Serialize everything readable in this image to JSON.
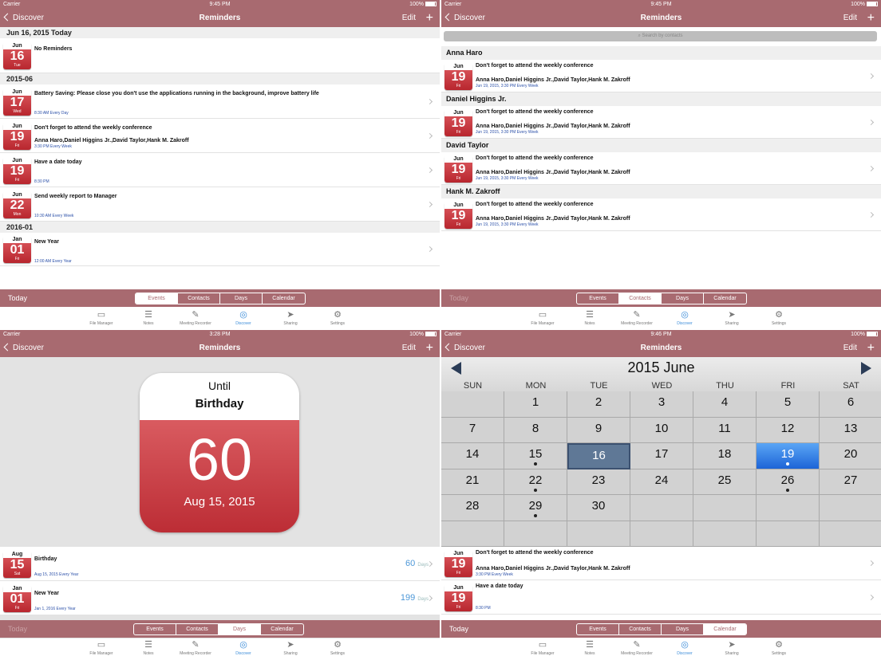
{
  "status": {
    "carrier": "Carrier",
    "battery": "100%",
    "times": [
      "9:45 PM",
      "9:45 PM",
      "3:28 PM",
      "9:46 PM"
    ]
  },
  "nav": {
    "back": "Discover",
    "title": "Reminders",
    "edit": "Edit",
    "plus": "+"
  },
  "segments": [
    "Events",
    "Contacts",
    "Days",
    "Calendar"
  ],
  "toolbar_today": "Today",
  "tabs": [
    "File Manager",
    "Notes",
    "Meeting Recorder",
    "Discover",
    "Sharing",
    "Settings"
  ],
  "events": {
    "sections": [
      {
        "header": "Jun 16, 2015 Today",
        "rows": [
          {
            "mon": "Jun",
            "day": "16",
            "wd": "Tue",
            "title": "No Reminders",
            "sub1": "",
            "sub2": ""
          }
        ]
      },
      {
        "header": "2015-06",
        "rows": [
          {
            "mon": "Jun",
            "day": "17",
            "wd": "Wed",
            "title": "Battery Saving: Please close you don't use the applications running in the background, improve battery life",
            "sub1": "",
            "sub2": "8:30 AM Every Day"
          },
          {
            "mon": "Jun",
            "day": "19",
            "wd": "Fri",
            "title": "Don't forget to attend the weekly conference",
            "sub1": "Anna Haro,Daniel Higgins Jr.,David Taylor,Hank M. Zakroff",
            "sub2": "3:30 PM Every Week"
          },
          {
            "mon": "Jun",
            "day": "19",
            "wd": "Fri",
            "title": "Have a date today",
            "sub1": "",
            "sub2": "8:30 PM"
          },
          {
            "mon": "Jun",
            "day": "22",
            "wd": "Mon",
            "title": "Send weekly report to Manager",
            "sub1": "",
            "sub2": "10:30 AM Every Week"
          }
        ]
      },
      {
        "header": "2016-01",
        "rows": [
          {
            "mon": "Jan",
            "day": "01",
            "wd": "Fri",
            "title": "New Year",
            "sub1": "",
            "sub2": "12:00 AM Every Year"
          }
        ]
      }
    ]
  },
  "contacts": {
    "search_placeholder": "Search by contacts",
    "people": [
      {
        "name": "Anna Haro",
        "mon": "Jun",
        "day": "19",
        "wd": "Fri",
        "title": "Don't forget to attend the weekly conference",
        "sub1": "Anna Haro,Daniel Higgins Jr.,David Taylor,Hank M. Zakroff",
        "sub2": "Jun 19, 2015, 3:30 PM Every Week"
      },
      {
        "name": "Daniel Higgins Jr.",
        "mon": "Jun",
        "day": "19",
        "wd": "Fri",
        "title": "Don't forget to attend the weekly conference",
        "sub1": "Anna Haro,Daniel Higgins Jr.,David Taylor,Hank M. Zakroff",
        "sub2": "Jun 19, 2015, 3:30 PM Every Week"
      },
      {
        "name": "David Taylor",
        "mon": "Jun",
        "day": "19",
        "wd": "Fri",
        "title": "Don't forget to attend the weekly conference",
        "sub1": "Anna Haro,Daniel Higgins Jr.,David Taylor,Hank M. Zakroff",
        "sub2": "Jun 19, 2015, 3:30 PM Every Week"
      },
      {
        "name": "Hank M. Zakroff",
        "mon": "Jun",
        "day": "19",
        "wd": "Fri",
        "title": "Don't forget to attend the weekly conference",
        "sub1": "Anna Haro,Daniel Higgins Jr.,David Taylor,Hank M. Zakroff",
        "sub2": "Jun 19, 2015, 3:30 PM Every Week"
      }
    ]
  },
  "days": {
    "card": {
      "until": "Until",
      "name": "Birthday",
      "count": "60",
      "date": "Aug 15, 2015"
    },
    "rows": [
      {
        "mon": "Aug",
        "day": "15",
        "wd": "Sat",
        "title": "Birthday",
        "sub2": "Aug 15, 2015 Every Year",
        "count": "60",
        "unit": "Days"
      },
      {
        "mon": "Jan",
        "day": "01",
        "wd": "Fri",
        "title": "New Year",
        "sub2": "Jan 1, 2016 Every Year",
        "count": "199",
        "unit": "Days"
      }
    ]
  },
  "calendar": {
    "month": "2015 June",
    "weekdays": [
      "SUN",
      "MON",
      "TUE",
      "WED",
      "THU",
      "FRI",
      "SAT"
    ],
    "days": [
      "",
      "1",
      "2",
      "3",
      "4",
      "5",
      "6",
      "7",
      "8",
      "9",
      "10",
      "11",
      "12",
      "13",
      "14",
      "15",
      "16",
      "17",
      "18",
      "19",
      "20",
      "21",
      "22",
      "23",
      "24",
      "25",
      "26",
      "27",
      "28",
      "29",
      "30",
      "",
      "",
      "",
      "",
      "",
      "",
      "",
      "",
      "",
      "",
      "",
      ""
    ],
    "dots": [
      "15",
      "19",
      "22",
      "26",
      "29"
    ],
    "selected": "16",
    "today": "19",
    "rows": [
      {
        "mon": "Jun",
        "day": "19",
        "wd": "Fri",
        "title": "Don't forget to attend the weekly conference",
        "sub1": "Anna Haro,Daniel Higgins Jr.,David Taylor,Hank M. Zakroff",
        "sub2": "3:30 PM Every Week"
      },
      {
        "mon": "Jun",
        "day": "19",
        "wd": "Fri",
        "title": "Have a date today",
        "sub1": "",
        "sub2": "8:30 PM"
      }
    ]
  },
  "colors": {
    "brand": "#a86a70",
    "accent": "#3d8dd9",
    "calendar_red": "#c0353c"
  }
}
